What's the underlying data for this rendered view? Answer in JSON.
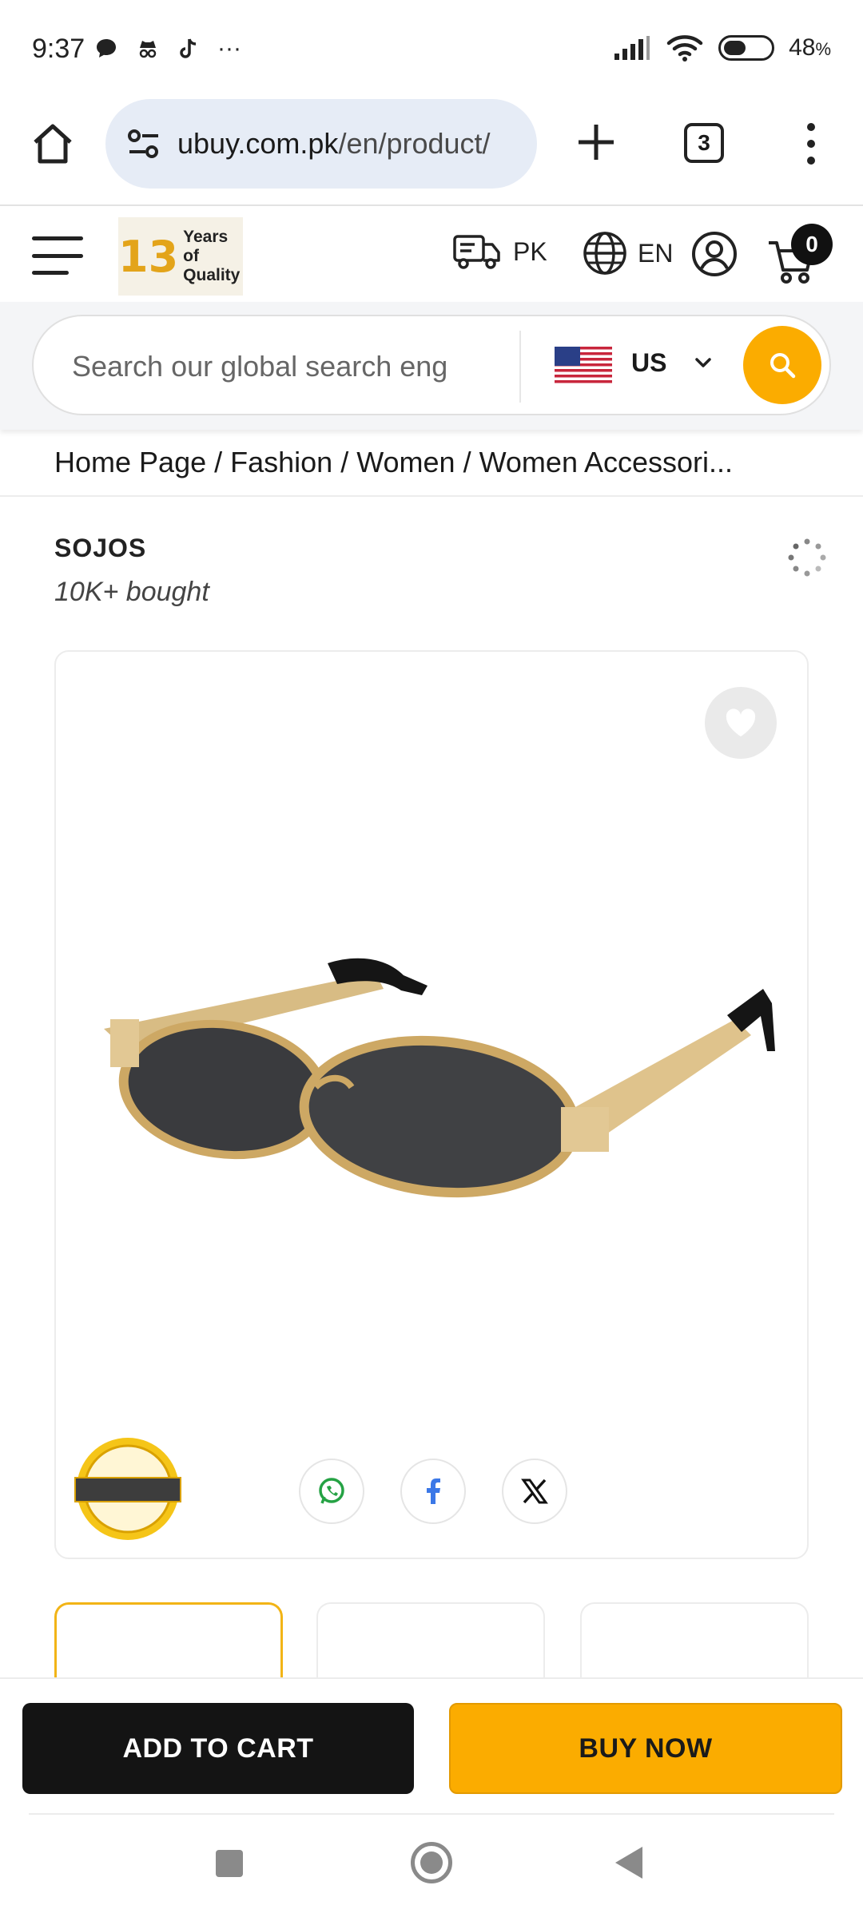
{
  "status_bar": {
    "time": "9:37",
    "more": "···",
    "battery_percent": "48",
    "battery_suffix": "%",
    "battery_level": 0.48
  },
  "browser": {
    "url_domain": "ubuy.com.pk",
    "url_path": "/en/product/",
    "tab_count": "3"
  },
  "header": {
    "logo_number": "13",
    "logo_line1": "Years of",
    "logo_line2": "Quality",
    "ship_to": "PK",
    "language": "EN",
    "cart_count": "0"
  },
  "search": {
    "placeholder": "Search our global search eng",
    "country": "US"
  },
  "breadcrumb": {
    "text": "Home Page / Fashion / Women / Women Accessori..."
  },
  "product": {
    "brand": "SOJOS",
    "bought": "10K+ bought"
  },
  "actions": {
    "add_to_cart": "ADD TO CART",
    "buy_now": "BUY NOW"
  },
  "colors": {
    "accent": "#fbac00",
    "dark_button": "#141414",
    "thumb_active_border": "#f2b416",
    "url_bar": "#e6ecf6"
  }
}
